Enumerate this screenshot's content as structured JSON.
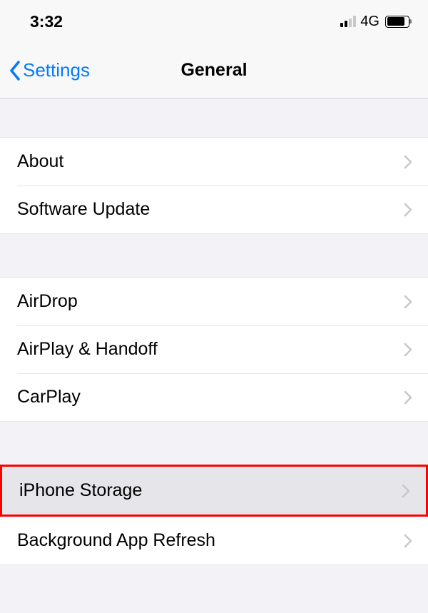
{
  "statusBar": {
    "time": "3:32",
    "networkLabel": "4G"
  },
  "navHeader": {
    "backLabel": "Settings",
    "title": "General"
  },
  "sections": {
    "group1": {
      "about": "About",
      "softwareUpdate": "Software Update"
    },
    "group2": {
      "airdrop": "AirDrop",
      "airplayHandoff": "AirPlay & Handoff",
      "carplay": "CarPlay"
    },
    "group3": {
      "iphoneStorage": "iPhone Storage",
      "backgroundAppRefresh": "Background App Refresh"
    }
  }
}
